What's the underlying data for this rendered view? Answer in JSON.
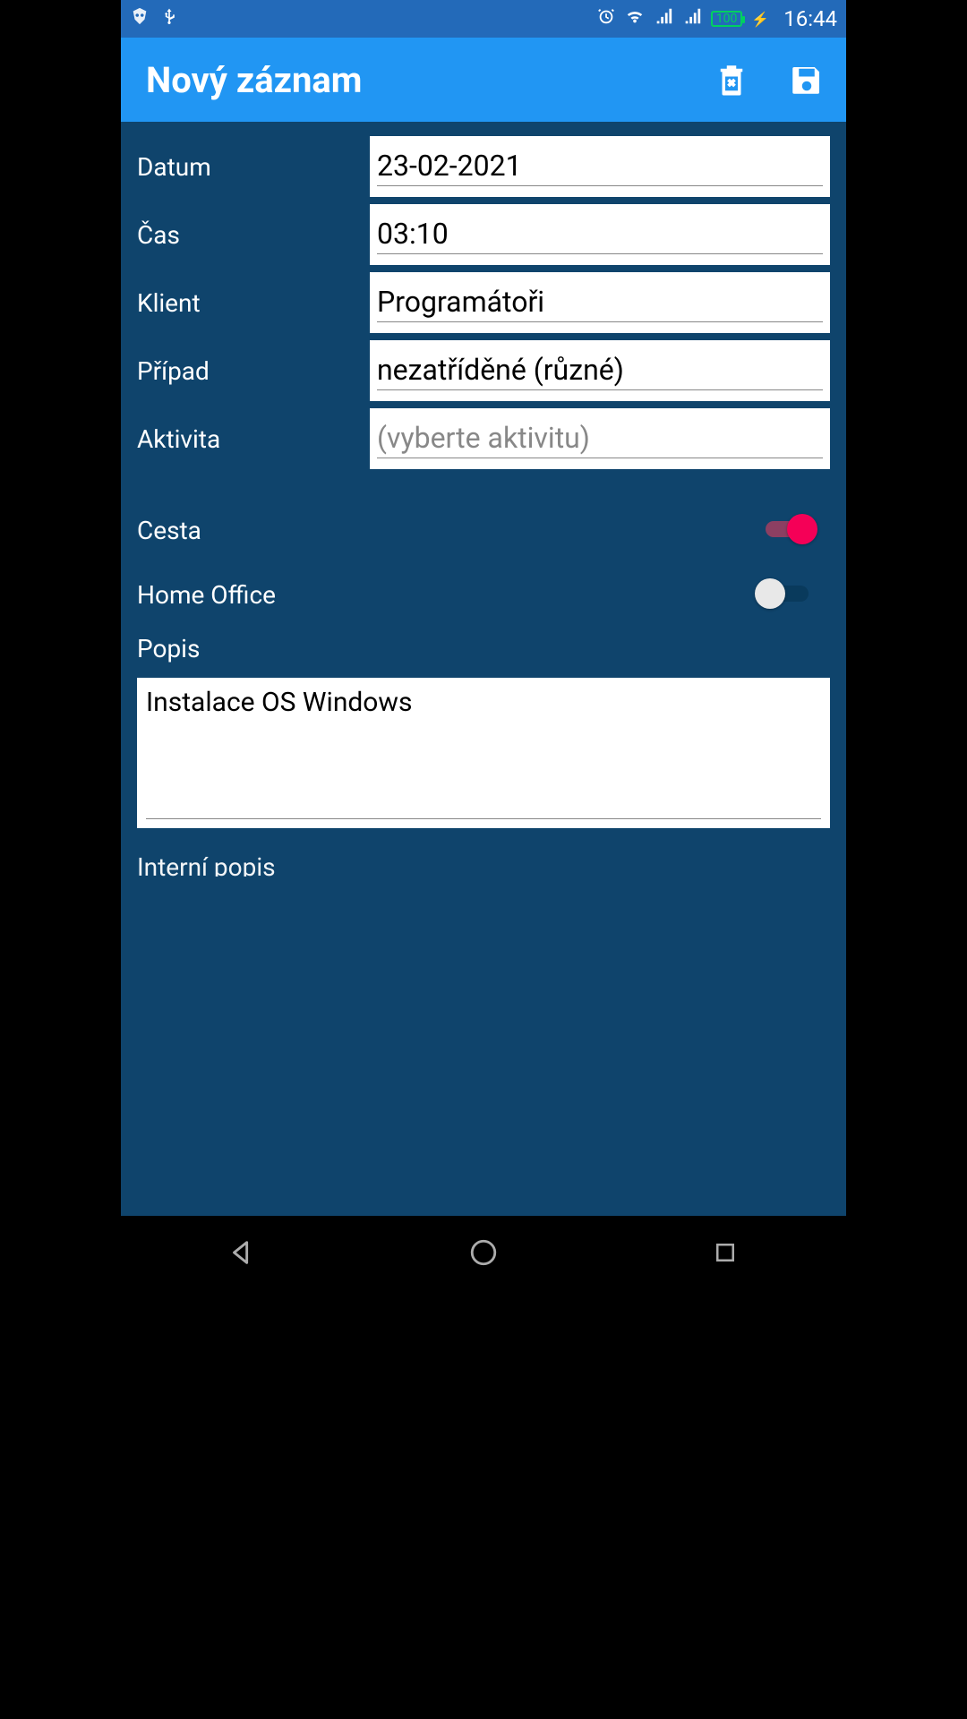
{
  "status": {
    "time": "16:44",
    "battery": "100"
  },
  "appbar": {
    "title": "Nový záznam"
  },
  "form": {
    "date_label": "Datum",
    "date_value": "23-02-2021",
    "time_label": "Čas",
    "time_value": "03:10",
    "client_label": "Klient",
    "client_value": "Programátoři",
    "case_label": "Případ",
    "case_value": "nezatříděné (různé)",
    "activity_label": "Aktivita",
    "activity_placeholder": "(vyberte aktivitu)",
    "cesta_label": "Cesta",
    "cesta_on": true,
    "homeoffice_label": "Home Office",
    "homeoffice_on": false,
    "popis_label": "Popis",
    "popis_value": "Instalace OS Windows",
    "interni_label": "Interní popis"
  }
}
